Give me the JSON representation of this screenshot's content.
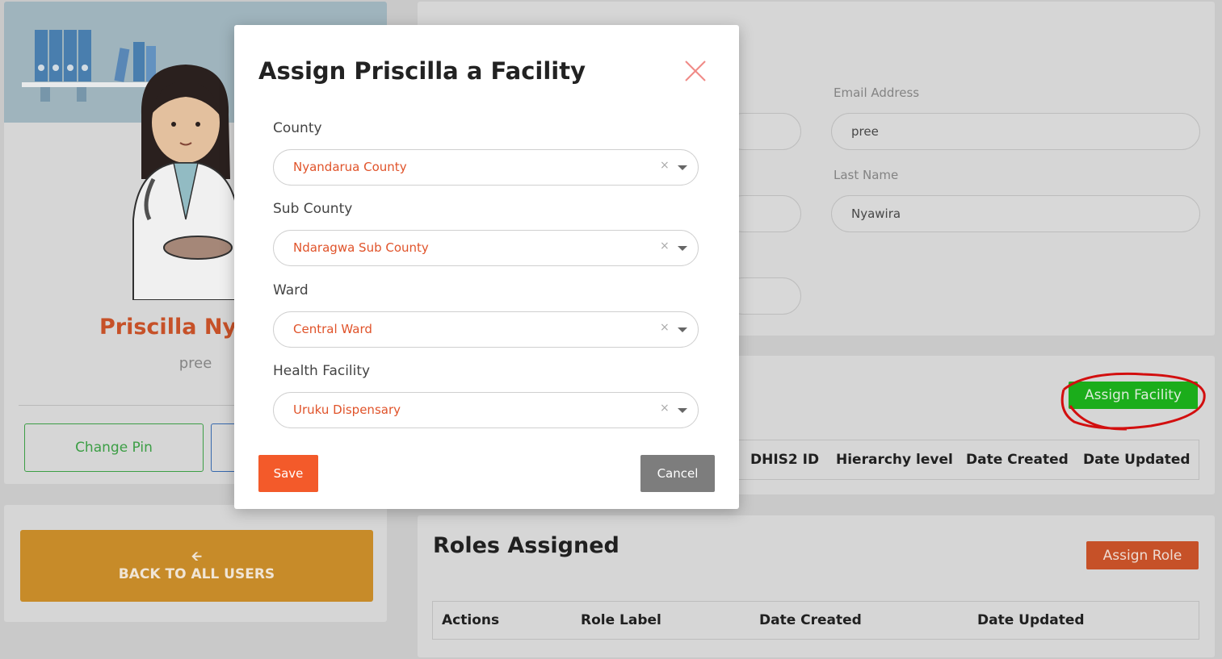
{
  "profile": {
    "name": "Priscilla Nyawira",
    "email": "pree",
    "change_pin_label": "Change Pin"
  },
  "back_button": {
    "label": "BACK TO ALL USERS",
    "icon": "arrow-left-icon"
  },
  "details": {
    "email_label": "Email Address",
    "email_value": "pree",
    "last_name_label": "Last Name",
    "last_name_value": "Nyawira"
  },
  "facility_section": {
    "assign_label": "Assign Facility",
    "columns": [
      "DHIS2 ID",
      "Hierarchy level",
      "Date Created",
      "Date Updated"
    ]
  },
  "roles_section": {
    "title": "Roles Assigned",
    "assign_label": "Assign Role",
    "columns": [
      "Actions",
      "Role Label",
      "Date Created",
      "Date Updated"
    ]
  },
  "modal": {
    "title": "Assign Priscilla a Facility",
    "fields": [
      {
        "label": "County",
        "value": "Nyandarua County"
      },
      {
        "label": "Sub County",
        "value": "Ndaragwa Sub County"
      },
      {
        "label": "Ward",
        "value": "Central Ward"
      },
      {
        "label": "Health Facility",
        "value": "Uruku Dispensary"
      }
    ],
    "clear_glyph": "×",
    "save_label": "Save",
    "cancel_label": "Cancel"
  },
  "colors": {
    "accent_orange": "#f35a2a",
    "name_orange": "#d3572b",
    "assign_green": "#1db81d",
    "back_button": "#d4942c",
    "annotation_red": "#e01010"
  }
}
